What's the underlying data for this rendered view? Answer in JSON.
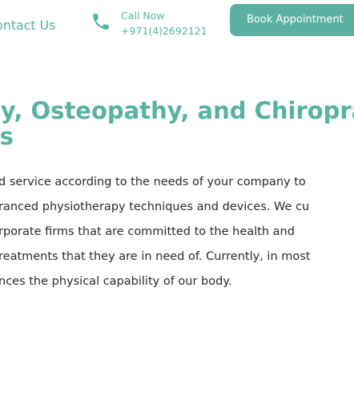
{
  "header": {
    "contact_label": "ontact Us",
    "call_label": "Call Now",
    "call_number": "+971(4)2692121",
    "book_label": "Book Appointment",
    "phone_icon": "phone-icon",
    "accent_color": "#58b2a4"
  },
  "main": {
    "heading_lines": [
      "py, Osteopathy, and Chiropra",
      "es"
    ],
    "body_lines": [
      "d service according to the needs of your company to",
      "ranced physiotherapy techniques and devices. We cu",
      "rporate firms that are committed to the health and",
      "reatments that they are in need of. Currently, in most",
      "nces the physical capability of our body."
    ]
  }
}
